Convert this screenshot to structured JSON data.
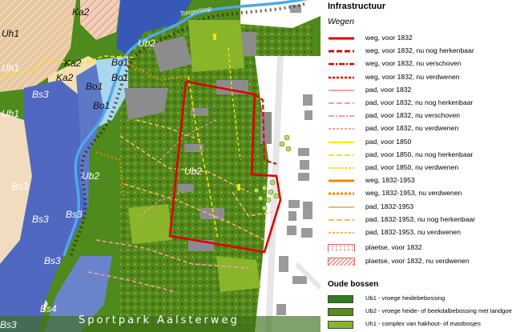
{
  "map": {
    "labels": {
      "ka2_top": "Ka2",
      "uh1_left": "Uh1",
      "ka2_mid": "Ka2",
      "ka2_low": "Ka2",
      "uh1_mid": "Uh1",
      "bo1_a": "Bo1",
      "bo1_b": "Bo1",
      "bo1_c": "Bo1",
      "bo1_d": "Bo1",
      "ub2_top": "Ub2",
      "bs3_a": "Bs3",
      "uh1_b": "Uh1",
      "ub2_left": "Ub2",
      "ub2_center": "Ub2",
      "bs3_b": "Bs3",
      "bs3_c": "Bs3",
      "bs3_d": "Bs3",
      "bs3_e": "Bs3",
      "bs4": "Bs4",
      "bs3_f": "Bs3"
    },
    "water_label": "Tongerloop",
    "street_label": "Sportpark Aalsterweg"
  },
  "legend": {
    "title": "Infrastructuur",
    "subtitle": "Wegen",
    "items": [
      {
        "label": "weg, voor 1832",
        "color": "#e00000",
        "style": "solid",
        "width": 3
      },
      {
        "label": "weg, voor 1832, nu nog herkenbaar",
        "color": "#e00000",
        "style": "dash",
        "width": 3
      },
      {
        "label": "weg, voor 1832, nu verschoven",
        "color": "#e00000",
        "style": "dashdot",
        "width": 2.5
      },
      {
        "label": "weg, voor 1832, nu verdwenen",
        "color": "#e00000",
        "style": "dot",
        "width": 2.5
      },
      {
        "label": "pad, voor 1832",
        "color": "#f4a0a0",
        "style": "solid",
        "width": 2
      },
      {
        "label": "pad, voor 1832, nu nog herkenbaar",
        "color": "#f4a0a0",
        "style": "dash",
        "width": 2
      },
      {
        "label": "pad, voor 1832, nu verschoven",
        "color": "#f4a0a0",
        "style": "dashdot",
        "width": 2
      },
      {
        "label": "pad, voor 1832, nu verdwenen",
        "color": "#f4a0a0",
        "style": "dot",
        "width": 2
      },
      {
        "label": "pad, voor 1850",
        "color": "#f2e600",
        "style": "solid",
        "width": 2
      },
      {
        "label": "pad, voor 1850, nu nog herkenbaar",
        "color": "#f2e600",
        "style": "dash",
        "width": 2
      },
      {
        "label": "pad, voor 1850, nu verdwenen",
        "color": "#f2e600",
        "style": "dot",
        "width": 2
      },
      {
        "label": "weg, 1832-1953",
        "color": "#f08a00",
        "style": "solid",
        "width": 3
      },
      {
        "label": "weg, 1832-1953, nu verdwenen",
        "color": "#f08a00",
        "style": "dot",
        "width": 3
      },
      {
        "label": "pad, 1832-1953",
        "color": "#f5b85a",
        "style": "solid",
        "width": 2
      },
      {
        "label": "pad, 1832-1953, nu nog herkenbaar",
        "color": "#f5b85a",
        "style": "dash",
        "width": 2
      },
      {
        "label": "pad, 1832-1953, nu verdwenen",
        "color": "#f5b85a",
        "style": "dot",
        "width": 2
      }
    ],
    "area_items": [
      {
        "label": "plaetse, voor 1832",
        "kind": "dots"
      },
      {
        "label": "plaetse, voor 1832, nu verdwenen",
        "kind": "hatch"
      }
    ],
    "forest_title": "Oude bossen",
    "forest_items": [
      {
        "label": "Ub1 - vroege heidebebossing",
        "color": "#2e7d1e"
      },
      {
        "label": "Ub2 - vroege heide- of beekdalbebossing met landgoedkenmerken",
        "color": "#5a8a1a"
      },
      {
        "label": "Uh1 - complex van hakhout- of mastbosjes",
        "color": "#8ab42a"
      }
    ]
  }
}
